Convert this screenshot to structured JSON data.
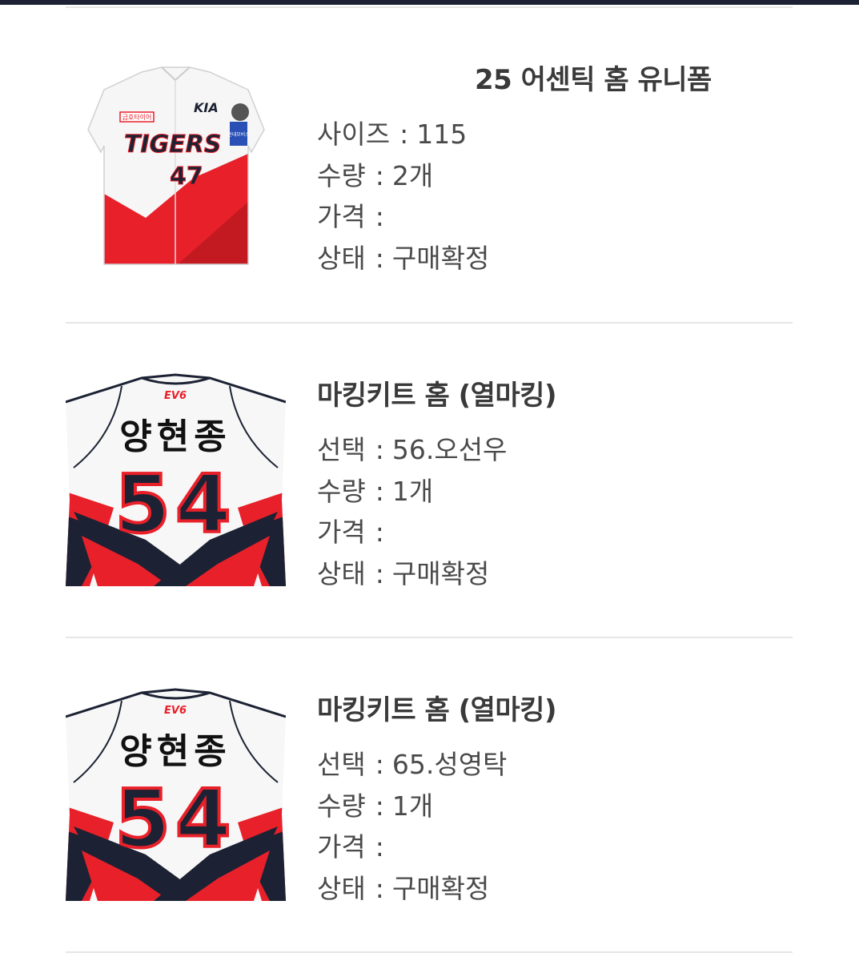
{
  "items": [
    {
      "title": "25 어센틱 홈 유니폼",
      "image": {
        "type": "front-jersey",
        "brand_text": "TIGERS",
        "sponsor_text": "KIA",
        "number": "47",
        "badge_text": "현대모비스",
        "patch_text": "금호타이어"
      },
      "rows": [
        {
          "label": "사이즈",
          "sep": ":",
          "value": "115"
        },
        {
          "label": "수량",
          "sep": ":",
          "value": "2개"
        },
        {
          "label": "가격",
          "sep": ":",
          "value": ""
        },
        {
          "label": "상태",
          "sep": ":",
          "value": "구매확정"
        }
      ]
    },
    {
      "title": "마킹키트 홈 (열마킹)",
      "image": {
        "type": "back-jersey",
        "logo_text": "EV6",
        "name_text": "양현종",
        "number": "54"
      },
      "rows": [
        {
          "label": "선택",
          "sep": ":",
          "value": "56.오선우"
        },
        {
          "label": "수량",
          "sep": ":",
          "value": "1개"
        },
        {
          "label": "가격",
          "sep": ":",
          "value": ""
        },
        {
          "label": "상태",
          "sep": ":",
          "value": "구매확정"
        }
      ]
    },
    {
      "title": "마킹키트 홈 (열마킹)",
      "image": {
        "type": "back-jersey",
        "logo_text": "EV6",
        "name_text": "양현종",
        "number": "54"
      },
      "rows": [
        {
          "label": "선택",
          "sep": ":",
          "value": "65.성영탁"
        },
        {
          "label": "수량",
          "sep": ":",
          "value": "1개"
        },
        {
          "label": "가격",
          "sep": ":",
          "value": ""
        },
        {
          "label": "상태",
          "sep": ":",
          "value": "구매확정"
        }
      ]
    }
  ],
  "colors": {
    "accent_red": "#e8202a",
    "navy": "#1c2233",
    "text": "#4a4a4a",
    "divider": "#e6e6e6"
  }
}
